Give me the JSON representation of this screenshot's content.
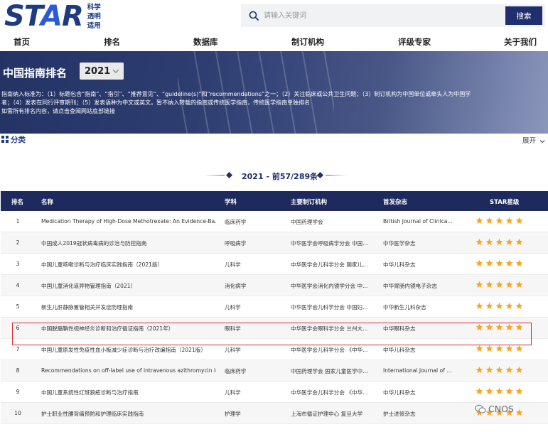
{
  "brand": {
    "word_pre": "ST",
    "word_a": "A",
    "word_post": "R",
    "sub": [
      "科学",
      "透明",
      "适用"
    ]
  },
  "search": {
    "placeholder": "请输入关键词",
    "button_label": "搜索"
  },
  "nav": [
    "首页",
    "排名",
    "数据库",
    "制订机构",
    "评级专家",
    "关于我们"
  ],
  "banner": {
    "title": "中国指南排名",
    "year": "2021",
    "criteria_lines": [
      "指南纳入标准为：（1）标题包含“指南”、“指引”、“推荐意见”、“guideline(s)”和“recommendations”之一；（2）关注临床或公共卫生问题；（3）制订机构为中国单位或牵头人为中国学",
      "者；（4）发表在同行评审期刊；（5）发表语种为中文或英文。暂不纳入转载的指南或传统医学指南，传统医学指南单独排名",
      "如需所有排名内容，请点击查阅网站底部链接"
    ]
  },
  "category": {
    "label": "分类",
    "expand_label": "展开"
  },
  "section_title": "2021 - 前57/289条",
  "table": {
    "headers": [
      "排名",
      "名称",
      "学科",
      "主要制订机构",
      "首发杂志",
      "STAR星级"
    ],
    "rows": [
      {
        "rank": "1",
        "name": "Medication Therapy of High-Dose Methotrexate: An Evidence-Ba...",
        "subject": "临床药学",
        "org": "中国药理学会",
        "journal": "British Journal of Clinica...",
        "stars": 5
      },
      {
        "rank": "2",
        "name": "中国成人2019冠状病毒病的诊治与防控指南",
        "subject": "呼吸病学",
        "org": "中华医学会呼吸病学分会 中国...",
        "journal": "中华医学杂志",
        "stars": 5
      },
      {
        "rank": "3",
        "name": "中国儿童咳嗽诊断与治疗临床实践指南（2021版）",
        "subject": "儿科学",
        "org": "中华医学会儿科学分会 国家儿...",
        "journal": "中华儿科杂志",
        "stars": 5
      },
      {
        "rank": "4",
        "name": "中国儿童消化道异物管理指南（2021）",
        "subject": "消化病学",
        "org": "中华医学会消化内镜学分会 中...",
        "journal": "中华胃肠内镜电子杂志",
        "stars": 5
      },
      {
        "rank": "5",
        "name": "新生儿肝静脉置管相关并发症防理指南",
        "subject": "儿科学",
        "org": "中华医学会儿科学分会 中国妇...",
        "journal": "中华新生儿科杂志",
        "stars": 5
      },
      {
        "rank": "6",
        "name": "中国脱髓鞘性视神经炎诊断和治疗循证指南（2021年）",
        "subject": "眼科学",
        "org": "中华医学会眼科学分会 兰州大...",
        "journal": "中华眼科杂志",
        "stars": 5
      },
      {
        "rank": "7",
        "name": "中国儿童原发性免疫性血小板减少症诊断与治疗改编指南（2021版）",
        "subject": "儿科学",
        "org": "中华医学会儿科学分会 《中华...",
        "journal": "中华儿科杂志",
        "stars": 5
      },
      {
        "rank": "8",
        "name": "Recommendations on off-label use of intravenous azithromycin in...",
        "subject": "临床药学",
        "org": "中国药理学会 国家儿童医学中...",
        "journal": "International Journal of ...",
        "stars": 5
      },
      {
        "rank": "9",
        "name": "中国儿童系统性红斑狼疮诊断与治疗指南",
        "subject": "儿科学",
        "org": "中华医学会儿科学分会 《中华...",
        "journal": "中华儿科杂志",
        "stars": 5
      },
      {
        "rank": "10",
        "name": "护士职业性腰背痛预防和护理临床实践指南",
        "subject": "护理学",
        "org": "上海市循证护理中心 复旦大学",
        "journal": "护士进修杂志",
        "stars": 5
      }
    ]
  },
  "watermark": "CNOS",
  "colors": {
    "navy": "#1e2a5e",
    "star": "#f5a623",
    "highlight": "#d9272e"
  }
}
